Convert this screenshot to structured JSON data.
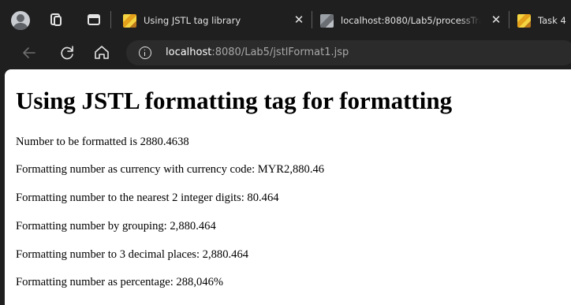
{
  "browser": {
    "tabs": [
      {
        "title": "Using JSTL tag library",
        "active": true
      },
      {
        "title": "localhost:8080/Lab5/processTrainee",
        "active": false
      },
      {
        "title": "Task 4",
        "active": false
      }
    ],
    "address": {
      "host": "localhost",
      "path": ":8080/Lab5/jstlFormat1.jsp"
    },
    "icons": [
      "profile-icon",
      "collections-icon",
      "tab-actions-icon",
      "back-icon",
      "reload-icon",
      "home-icon",
      "info-icon",
      "close-icon"
    ]
  },
  "page": {
    "heading": "Using JSTL formatting tag for formatting",
    "lines": [
      "Number to be formatted is 2880.4638",
      "Formatting number as currency with currency code: MYR2,880.46",
      "Formatting number to the nearest 2 integer digits: 80.464",
      "Formatting number by grouping: 2,880.464",
      "Formatting number to 3 decimal places: 2,880.464",
      "Formatting number as percentage: 288,046%"
    ]
  },
  "colors": {
    "chrome_background": "#1f1f1f",
    "addressbar_background": "#2b2b2b",
    "page_background": "#ffffff"
  }
}
